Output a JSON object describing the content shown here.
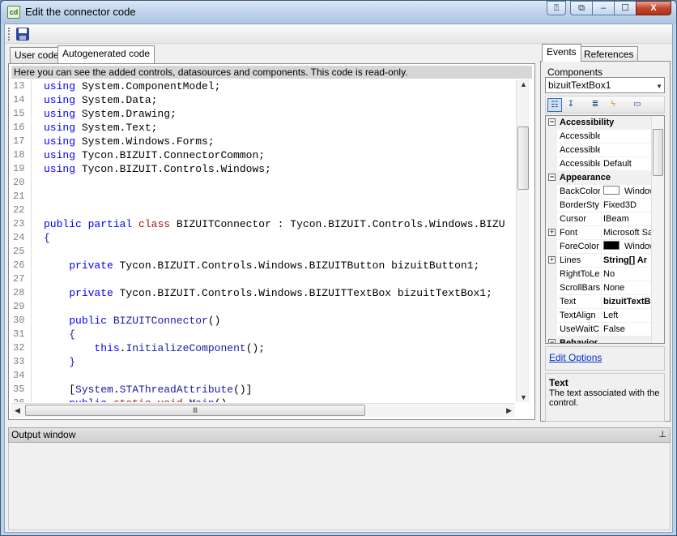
{
  "window": {
    "title": "Edit the connector code",
    "icon_text": "cd",
    "buttons": {
      "help": "⍰",
      "restore_alt": "⧉",
      "minimize": "–",
      "maximize": "☐",
      "close": "X"
    }
  },
  "toolbar": {
    "save_icon": "save-icon"
  },
  "tabs": {
    "user_code": "User code",
    "autogenerated_code": "Autogenerated code"
  },
  "code": {
    "notice": "Here you can see the added controls, datasources and components. This code is read-only.",
    "lines": [
      {
        "n": "13",
        "parts": [
          [
            "kw",
            "using"
          ],
          [
            "t",
            " System.ComponentModel;"
          ]
        ]
      },
      {
        "n": "14",
        "parts": [
          [
            "kw",
            "using"
          ],
          [
            "t",
            " System.Data;"
          ]
        ]
      },
      {
        "n": "15",
        "parts": [
          [
            "kw",
            "using"
          ],
          [
            "t",
            " System.Drawing;"
          ]
        ]
      },
      {
        "n": "16",
        "parts": [
          [
            "kw",
            "using"
          ],
          [
            "t",
            " System.Text;"
          ]
        ]
      },
      {
        "n": "17",
        "parts": [
          [
            "kw",
            "using"
          ],
          [
            "t",
            " System.Windows.Forms;"
          ]
        ]
      },
      {
        "n": "18",
        "parts": [
          [
            "kw",
            "using"
          ],
          [
            "t",
            " Tycon.BIZUIT.ConnectorCommon;"
          ]
        ]
      },
      {
        "n": "19",
        "parts": [
          [
            "kw",
            "using"
          ],
          [
            "t",
            " Tycon.BIZUIT.Controls.Windows;"
          ]
        ]
      },
      {
        "n": "20",
        "parts": []
      },
      {
        "n": "21",
        "parts": []
      },
      {
        "n": "22",
        "parts": []
      },
      {
        "n": "23",
        "parts": [
          [
            "kw",
            "public"
          ],
          [
            "t",
            " "
          ],
          [
            "kw",
            "partial"
          ],
          [
            "t",
            " "
          ],
          [
            "kw2",
            "class"
          ],
          [
            "t",
            " BIZUITConnector : Tycon.BIZUIT.Controls.Windows.BIZU"
          ]
        ]
      },
      {
        "n": "24",
        "parts": [
          [
            "ty",
            "{"
          ]
        ]
      },
      {
        "n": "25",
        "parts": []
      },
      {
        "n": "26",
        "parts": [
          [
            "t",
            "    "
          ],
          [
            "kw",
            "private"
          ],
          [
            "t",
            " Tycon.BIZUIT.Controls.Windows.BIZUITButton bizuitButton1;"
          ]
        ]
      },
      {
        "n": "27",
        "parts": []
      },
      {
        "n": "28",
        "parts": [
          [
            "t",
            "    "
          ],
          [
            "kw",
            "private"
          ],
          [
            "t",
            " Tycon.BIZUIT.Controls.Windows.BIZUITTextBox bizuitTextBox1;"
          ]
        ]
      },
      {
        "n": "29",
        "parts": []
      },
      {
        "n": "30",
        "parts": [
          [
            "t",
            "    "
          ],
          [
            "kw",
            "public"
          ],
          [
            "t",
            " "
          ],
          [
            "ty",
            "BIZUITConnector"
          ],
          [
            "t",
            "()"
          ]
        ]
      },
      {
        "n": "31",
        "parts": [
          [
            "t",
            "    "
          ],
          [
            "ty",
            "{"
          ]
        ]
      },
      {
        "n": "32",
        "parts": [
          [
            "t",
            "        "
          ],
          [
            "kw",
            "this"
          ],
          [
            "t",
            "."
          ],
          [
            "ty",
            "InitializeComponent"
          ],
          [
            "t",
            "();"
          ]
        ]
      },
      {
        "n": "33",
        "parts": [
          [
            "t",
            "    "
          ],
          [
            "ty",
            "}"
          ]
        ]
      },
      {
        "n": "34",
        "parts": []
      },
      {
        "n": "35",
        "parts": [
          [
            "t",
            "    ["
          ],
          [
            "ty",
            "System"
          ],
          [
            "t",
            "."
          ],
          [
            "ty",
            "STAThreadAttribute"
          ],
          [
            "t",
            "()]"
          ]
        ]
      },
      {
        "n": "36",
        "parts": [
          [
            "t",
            "    "
          ],
          [
            "kw",
            "public"
          ],
          [
            "t",
            " "
          ],
          [
            "kw2",
            "static"
          ],
          [
            "t",
            " "
          ],
          [
            "kw2",
            "void"
          ],
          [
            "t",
            " "
          ],
          [
            "ty",
            "Main"
          ],
          [
            "t",
            "()"
          ]
        ]
      }
    ]
  },
  "right": {
    "tabs": {
      "events": "Events",
      "references": "References"
    },
    "components_label": "Components",
    "component_selected": "bizuitTextBox1",
    "grid": [
      {
        "cat": true,
        "name": "Accessibility",
        "exp": "⊟"
      },
      {
        "name": "Accessible",
        "value": ""
      },
      {
        "name": "Accessible",
        "value": ""
      },
      {
        "name": "Accessible",
        "value": "Default"
      },
      {
        "cat": true,
        "name": "Appearance",
        "exp": "⊟"
      },
      {
        "name": "BackColor",
        "value": "Window",
        "swatch": "#ffffff"
      },
      {
        "name": "BorderSty",
        "value": "Fixed3D"
      },
      {
        "name": "Cursor",
        "value": "IBeam"
      },
      {
        "name": "Font",
        "value": "Microsoft Sa",
        "exp": "+"
      },
      {
        "name": "ForeColor",
        "value": "Window",
        "swatch": "#000000"
      },
      {
        "name": "Lines",
        "value": "String[] Ar",
        "exp": "+",
        "bold": true
      },
      {
        "name": "RightToLe",
        "value": "No"
      },
      {
        "name": "ScrollBars",
        "value": "None"
      },
      {
        "name": "Text",
        "value": "bizuitTextB",
        "bold": true
      },
      {
        "name": "TextAlign",
        "value": "Left"
      },
      {
        "name": "UseWaitC",
        "value": "False"
      },
      {
        "cat": true,
        "name": "Behavior",
        "exp": "⊟"
      }
    ],
    "edit_options": "Edit Options",
    "desc_title": "Text",
    "desc_body": "The text associated with the control."
  },
  "output": {
    "title": "Output window",
    "pin": "⊥"
  }
}
